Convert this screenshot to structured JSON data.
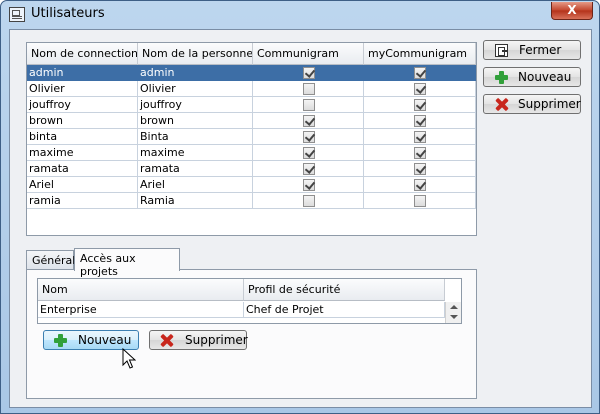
{
  "window": {
    "title": "Utilisateurs",
    "close_glyph": "X"
  },
  "users": {
    "columns": [
      "Nom de connection",
      "Nom de la personne",
      "Communigram",
      "myCommunigram"
    ],
    "rows": [
      {
        "login": "admin",
        "name": "admin",
        "communigram": true,
        "my_communigram": true,
        "selected": true
      },
      {
        "login": "Olivier",
        "name": "Olivier",
        "communigram": false,
        "my_communigram": true
      },
      {
        "login": "jouffroy",
        "name": "jouffroy",
        "communigram": false,
        "my_communigram": true
      },
      {
        "login": "brown",
        "name": "brown",
        "communigram": true,
        "my_communigram": true
      },
      {
        "login": "binta",
        "name": "Binta",
        "communigram": true,
        "my_communigram": true
      },
      {
        "login": "maxime",
        "name": "maxime",
        "communigram": true,
        "my_communigram": true
      },
      {
        "login": "ramata",
        "name": "ramata",
        "communigram": true,
        "my_communigram": true
      },
      {
        "login": "Ariel",
        "name": "Ariel",
        "communigram": true,
        "my_communigram": true
      },
      {
        "login": "ramia",
        "name": "Ramia",
        "communigram": false,
        "my_communigram": false
      }
    ]
  },
  "actions": {
    "close": "Fermer",
    "new": "Nouveau",
    "delete": "Supprimer"
  },
  "tabs": [
    {
      "label": "Général",
      "active": false
    },
    {
      "label": "Accès aux projets",
      "active": true
    }
  ],
  "projects": {
    "columns": [
      "Nom",
      "Profil de sécurité"
    ],
    "rows": [
      {
        "name": "Enterprise",
        "profile": "Chef de Projet"
      }
    ],
    "new_label": "Nouveau",
    "delete_label": "Supprimer"
  },
  "icons": {
    "close": "exit-icon",
    "add": "plus-icon",
    "remove": "x-icon",
    "pointer": "cursor-icon"
  },
  "colors": {
    "selection": "#3d6ea6",
    "add_icon": "#31a03a",
    "remove_icon": "#c8261c"
  }
}
